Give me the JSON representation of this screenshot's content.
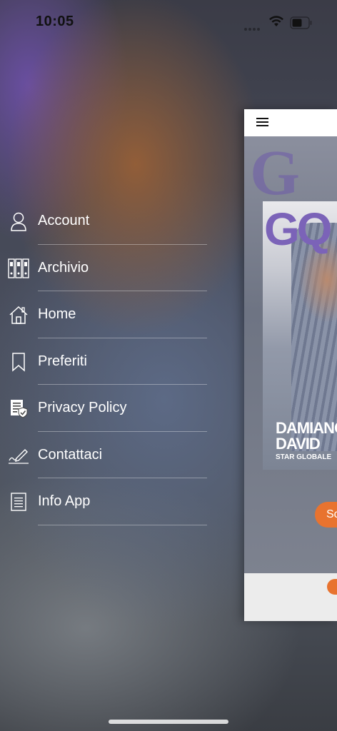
{
  "status_bar": {
    "time": "10:05"
  },
  "menu": {
    "items": [
      {
        "label": "Account",
        "icon": "person-icon"
      },
      {
        "label": "Archivio",
        "icon": "binders-icon"
      },
      {
        "label": "Home",
        "icon": "home-icon"
      },
      {
        "label": "Preferiti",
        "icon": "bookmark-icon"
      },
      {
        "label": "Privacy Policy",
        "icon": "privacy-document-icon"
      },
      {
        "label": "Contattaci",
        "icon": "pen-signature-icon"
      },
      {
        "label": "Info App",
        "icon": "document-icon"
      }
    ]
  },
  "preview": {
    "background_brand": "G",
    "cover": {
      "brand": "GQ",
      "headline_line1": "DAMIANO",
      "headline_line2": "DAVID",
      "subtitle": "STAR GLOBALE"
    },
    "button_label": "Sc"
  },
  "colors": {
    "accent": "#e8732f",
    "brand_purple": "#7b63b8",
    "menu_text": "#ffffff"
  }
}
